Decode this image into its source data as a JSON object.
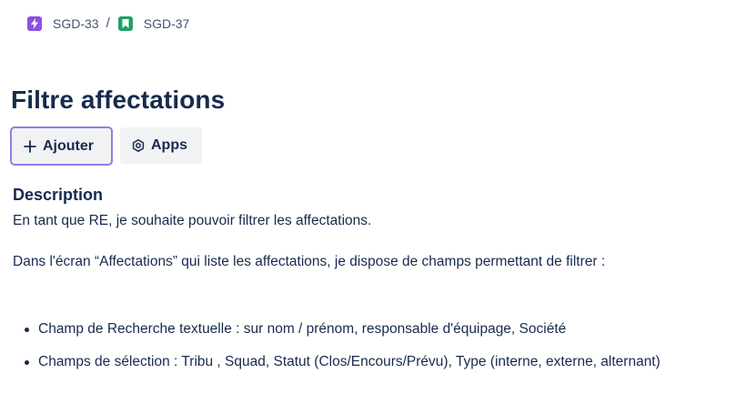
{
  "breadcrumb": {
    "items": [
      {
        "key": "SGD-33",
        "icon": "lightning-icon",
        "icon_color": "#904ee2"
      },
      {
        "key": "SGD-37",
        "icon": "bookmark-icon",
        "icon_color": "#22a06b"
      }
    ],
    "separator": "/"
  },
  "issue": {
    "title": "Filtre affectations"
  },
  "toolbar": {
    "add_label": "Ajouter",
    "add_icon": "plus-icon",
    "apps_label": "Apps",
    "apps_icon": "apps-gear-icon",
    "focus_color": "#8f7ee7"
  },
  "description": {
    "heading": "Description",
    "paragraphs": [
      "En tant que RE, je souhaite pouvoir filtrer les affectations.",
      "Dans l'écran “Affectations” qui liste les affectations, je dispose de champs permettant de filtrer :"
    ],
    "bullets": [
      "Champ de Recherche textuelle : sur nom / prénom, responsable d'équipage, Société",
      "Champs de sélection : Tribu , Squad, Statut (Clos/Encours/Prévu), Type (interne, externe, alternant)"
    ]
  }
}
